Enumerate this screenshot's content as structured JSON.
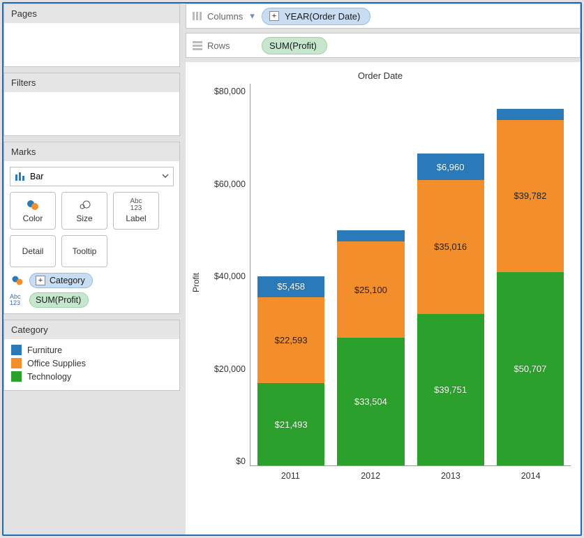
{
  "sidebar": {
    "pages": {
      "title": "Pages"
    },
    "filters": {
      "title": "Filters"
    },
    "marks": {
      "title": "Marks",
      "type": "Bar",
      "buttons": {
        "color": "Color",
        "size": "Size",
        "label": "Label",
        "detail": "Detail",
        "tooltip": "Tooltip"
      },
      "pills": {
        "category": "Category",
        "sum_profit": "SUM(Profit)"
      }
    },
    "legend": {
      "title": "Category",
      "items": [
        {
          "label": "Furniture",
          "color": "#2a7ab9"
        },
        {
          "label": "Office Supplies",
          "color": "#f28e2b"
        },
        {
          "label": "Technology",
          "color": "#2ca02c"
        }
      ]
    }
  },
  "shelves": {
    "columns": {
      "label": "Columns",
      "pill": "YEAR(Order Date)"
    },
    "rows": {
      "label": "Rows",
      "pill": "SUM(Profit)"
    }
  },
  "chart_data": {
    "type": "bar",
    "stacked": true,
    "title": "Order Date",
    "xlabel": "",
    "ylabel": "Profit",
    "ylim": [
      0,
      100000
    ],
    "yticks": [
      "$0",
      "$20,000",
      "$40,000",
      "$60,000",
      "$80,000"
    ],
    "categories": [
      "2011",
      "2012",
      "2013",
      "2014"
    ],
    "series": [
      {
        "name": "Technology",
        "color": "#2ca02c",
        "values": [
          21493,
          33504,
          39751,
          50707
        ],
        "labels": [
          "$21,493",
          "$33,504",
          "$39,751",
          "$50,707"
        ]
      },
      {
        "name": "Office Supplies",
        "color": "#f28e2b",
        "values": [
          22593,
          25100,
          35016,
          39782
        ],
        "labels": [
          "$22,593",
          "$25,100",
          "$35,016",
          "$39,782"
        ]
      },
      {
        "name": "Furniture",
        "color": "#2a7ab9",
        "values": [
          5458,
          3000,
          6960,
          3000
        ],
        "labels": [
          "$5,458",
          "",
          "$6,960",
          ""
        ]
      }
    ]
  }
}
